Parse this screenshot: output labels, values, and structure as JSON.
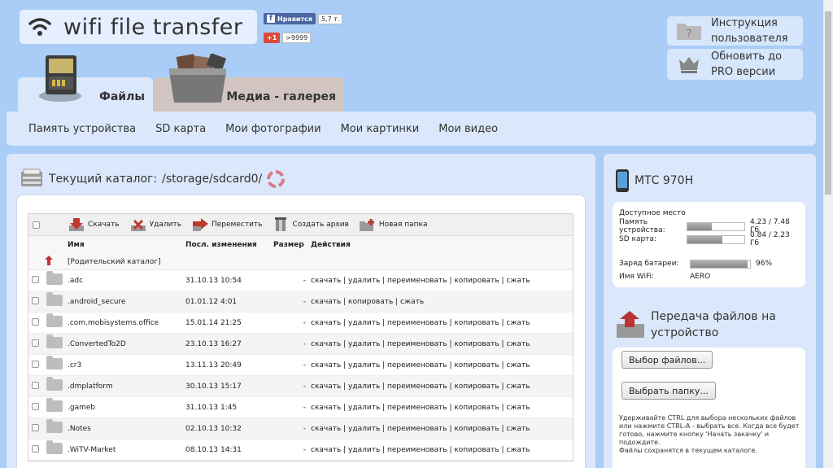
{
  "header": {
    "app_title": "wifi file transfer"
  },
  "social": {
    "fb_label": "Нравится",
    "fb_count": "5,7 т.",
    "gplus_label": "+1",
    "gplus_count": ">9999"
  },
  "right_buttons": [
    {
      "label": "Инструкция пользователя",
      "icon": "help-folder-icon"
    },
    {
      "label": "Обновить до PRO версии",
      "icon": "crown-icon"
    }
  ],
  "tabs": [
    {
      "label": "Файлы",
      "active": true,
      "icon": "sd-card-icon"
    },
    {
      "label": "Медиа - галерея",
      "active": false,
      "icon": "media-box-icon"
    }
  ],
  "nav": [
    "Память устройства",
    "SD карта",
    "Мои фотографии",
    "Мои картинки",
    "Мои видео"
  ],
  "current_dir": {
    "label": "Текущий каталог:",
    "path": "/storage/sdcard0/"
  },
  "toolbar": {
    "download": "Скачать",
    "delete": "Удалить",
    "move": "Переместить",
    "archive": "Создать архив",
    "new_folder": "Новая папка"
  },
  "columns": {
    "name": "Имя",
    "modified": "Посл. изменения",
    "size": "Размер",
    "actions": "Действия"
  },
  "parent_label": "[Родительский каталог]",
  "files": [
    {
      "name": ".adc",
      "date": "31.10.13 10:54",
      "size": "-",
      "actions": "скачать | удалить | переименовать | копировать | сжать"
    },
    {
      "name": ".android_secure",
      "date": "01.01.12 4:01",
      "size": "-",
      "actions": "скачать | копировать | сжать"
    },
    {
      "name": ".com.mobisystems.office",
      "date": "15.01.14 21:25",
      "size": "-",
      "actions": "скачать | удалить | переименовать | копировать | сжать"
    },
    {
      "name": ".ConvertedTo2D",
      "date": "23.10.13 16:27",
      "size": "-",
      "actions": "скачать | удалить | переименовать | копировать | сжать"
    },
    {
      "name": ".cr3",
      "date": "13.11.13 20:49",
      "size": "-",
      "actions": "скачать | удалить | переименовать | копировать | сжать"
    },
    {
      "name": ".dmplatform",
      "date": "30.10.13 15:17",
      "size": "-",
      "actions": "скачать | удалить | переименовать | копировать | сжать"
    },
    {
      "name": ".gameb",
      "date": "31.10.13 1:45",
      "size": "-",
      "actions": "скачать | удалить | переименовать | копировать | сжать"
    },
    {
      "name": ".Notes",
      "date": "02.10.13 10:32",
      "size": "-",
      "actions": "скачать | удалить | переименовать | копировать | сжать"
    },
    {
      "name": ".WiTV-Market",
      "date": "08.10.13 14:31",
      "size": "-",
      "actions": "скачать | удалить | переименовать | копировать | сжать"
    }
  ],
  "device": {
    "name": "МТС 970Н",
    "free_space_label": "Доступное место",
    "memory_label": "Память устройства:",
    "memory_value": "4.23 / 7.48 Гб",
    "memory_fraction": 0.43,
    "sd_label": "SD карта:",
    "sd_value": "0.84 / 2.23 Гб",
    "sd_fraction": 0.62,
    "battery_label": "Заряд батареи:",
    "battery_value": "96%",
    "battery_fraction": 0.96,
    "wifi_label": "Имя WiFi:",
    "wifi_value": "AERO"
  },
  "upload": {
    "title": "Передача файлов на устройство",
    "select_files": "Выбор файлов...",
    "select_folder": "Выбрать папку...",
    "hint": "Удерживайте CTRL для выбора нескольких файлов или нажмите CTRL-A - выбрать все. Когда все будет готово, нажмите кнопку 'Начать закачку' и подождите.",
    "hint2": "Файлы сохранятся в текущем каталоге."
  }
}
